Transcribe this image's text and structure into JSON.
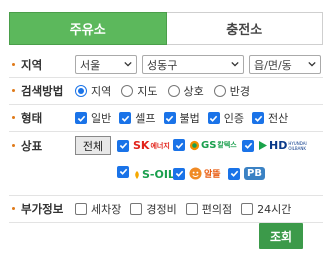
{
  "tabs": [
    {
      "label": "주유소",
      "active": true
    },
    {
      "label": "충전소",
      "active": false
    }
  ],
  "region": {
    "label": "지역",
    "sido": "서울",
    "sigungu": "성동구",
    "dong": "읍/면/동"
  },
  "search_method": {
    "label": "검색방법",
    "options": [
      {
        "label": "지역",
        "selected": true
      },
      {
        "label": "지도",
        "selected": false
      },
      {
        "label": "상호",
        "selected": false
      },
      {
        "label": "반경",
        "selected": false
      }
    ]
  },
  "type": {
    "label": "형태",
    "options": [
      {
        "label": "일반",
        "checked": true
      },
      {
        "label": "셀프",
        "checked": true
      },
      {
        "label": "불법",
        "checked": true
      },
      {
        "label": "인증",
        "checked": true
      },
      {
        "label": "전산",
        "checked": true
      }
    ]
  },
  "brand": {
    "label": "상표",
    "all_button": "전체",
    "brands": [
      {
        "name": "SK 에너지",
        "logo_text": "SK",
        "sub_text": "에너지",
        "checked": true,
        "color": "#e2231a"
      },
      {
        "name": "GS 칼텍스",
        "logo_text": "GS",
        "sub_text": "칼텍스",
        "checked": true,
        "color": "#1a9f4d"
      },
      {
        "name": "HD 현대오일뱅크",
        "logo_text": "HD",
        "sub_text": "HYUNDAI OILBANK",
        "checked": true,
        "color": "#0a3a8a"
      },
      {
        "name": "S-OIL",
        "logo_text": "S-OIL",
        "checked": true,
        "color": "#1a9f4d"
      },
      {
        "name": "알뜰",
        "logo_text": "알뜰",
        "checked": true,
        "color": "#e8590c"
      },
      {
        "name": "PB",
        "logo_text": "PB",
        "checked": true,
        "color": "#3b82c4"
      }
    ]
  },
  "extra": {
    "label": "부가정보",
    "options": [
      {
        "label": "세차장",
        "checked": false
      },
      {
        "label": "경정비",
        "checked": false
      },
      {
        "label": "편의점",
        "checked": false
      },
      {
        "label": "24시간",
        "checked": false
      }
    ]
  },
  "search_button": "조회",
  "colors": {
    "accent": "#5cb85c",
    "button": "#3c9a4a",
    "check": "#1a73e8",
    "bullet": "#e07a1a"
  }
}
